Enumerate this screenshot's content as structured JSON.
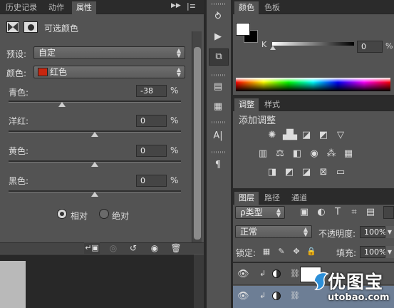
{
  "left_tabs": [
    "历史记录",
    "动作",
    "属性"
  ],
  "properties": {
    "title": "可选颜色",
    "preset_label": "预设:",
    "preset_value": "自定",
    "colors_label": "颜色:",
    "colors_value": "红色",
    "colors_swatch": "#c8260f",
    "sliders": [
      {
        "label": "青色:",
        "value": "-38",
        "unit": "%",
        "level": -38
      },
      {
        "label": "洋红:",
        "value": "0",
        "unit": "%",
        "level": 0
      },
      {
        "label": "黄色:",
        "value": "0",
        "unit": "%",
        "level": 0
      },
      {
        "label": "黑色:",
        "value": "0",
        "unit": "%",
        "level": 0
      }
    ],
    "method_relative": "相对",
    "method_absolute": "绝对",
    "method_selected": "relative"
  },
  "middle_tools": [
    "history-icon",
    "play-icon",
    "3d-icon",
    "notes-icon",
    "paragraph-styles-icon",
    "character-icon",
    "paragraph-icon"
  ],
  "color_panel": {
    "tabs": [
      "颜色",
      "色板"
    ],
    "channel": "K",
    "value": "0",
    "unit": "%",
    "foreground": "#ffffff",
    "background": "#000000"
  },
  "adjust_panel": {
    "tabs": [
      "调整",
      "样式"
    ],
    "title": "添加调整"
  },
  "layers_panel": {
    "tabs": [
      "图层",
      "路径",
      "通道"
    ],
    "filter_type": "ρ类型",
    "blend_mode": "正常",
    "opacity_label": "不透明度:",
    "opacity_value": "100%",
    "lock_label": "锁定:",
    "fill_label": "填充:",
    "fill_value": "100%"
  },
  "watermark": {
    "text": "优图宝",
    "url": "utobao.com"
  }
}
